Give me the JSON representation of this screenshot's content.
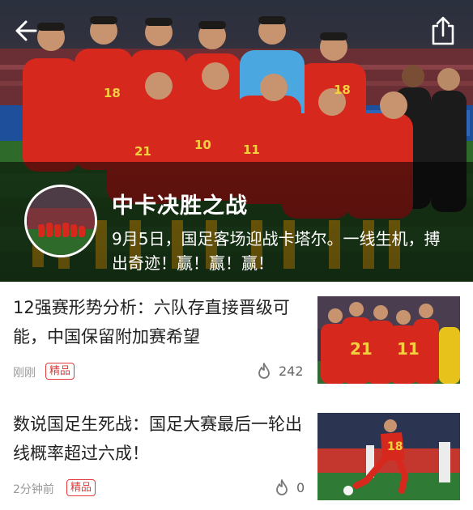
{
  "hero": {
    "title": "中卡决胜之战",
    "description": "9月5日，国足客场迎战卡塔尔。一线生机，搏出奇迹！赢！赢！赢！",
    "back_icon": "back-arrow-icon",
    "share_icon": "share-icon",
    "photo_jersey_numbers": [
      "18",
      "18",
      "21",
      "11",
      "10"
    ]
  },
  "articles": [
    {
      "title": "12强赛形势分析：六队存直接晋级可能，中国保留附加赛希望",
      "time": "刚刚",
      "badge": "精品",
      "count": "242",
      "thumb_jersey_numbers": [
        "21",
        "11"
      ]
    },
    {
      "title": "数说国足生死战：国足大赛最后一轮出线概率超过六成！",
      "time": "2分钟前",
      "badge": "精品",
      "count": "0",
      "thumb_jersey_numbers": [
        "18"
      ]
    }
  ],
  "colors": {
    "accent": "#e23a3a",
    "jersey": "#d7281e",
    "pitch": "#2e6b2b"
  }
}
